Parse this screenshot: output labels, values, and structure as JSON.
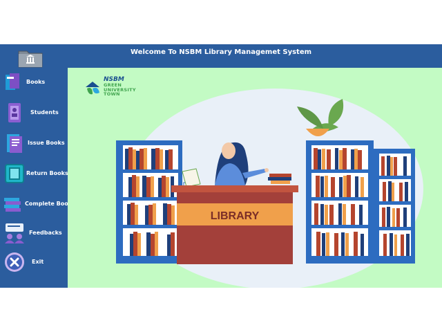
{
  "window": {
    "title": "Welcome To NSBM Library Managemet System"
  },
  "sidebar": {
    "logo_icon": "library-folder-icon",
    "items": [
      {
        "label": "Books",
        "icon": "books-icon"
      },
      {
        "label": "Students",
        "icon": "students-icon"
      },
      {
        "label": "Issue Books",
        "icon": "issue-books-icon"
      },
      {
        "label": "Return Books",
        "icon": "return-books-icon"
      },
      {
        "label": "Complete Books",
        "icon": "complete-books-icon"
      },
      {
        "label": "Feedbacks",
        "icon": "feedbacks-icon"
      },
      {
        "label": "Exit",
        "icon": "exit-icon"
      }
    ]
  },
  "brand": {
    "name": "NSBM",
    "tagline": "GREEN UNIVERSITY TOWN",
    "line1": "GREEN",
    "line2": "UNIVERSITY",
    "line3": "TOWN"
  },
  "illustration": {
    "sign": "LIBRARY"
  },
  "colors": {
    "sidebar": "#2b5d9e",
    "main_bg": "#c3fbc4",
    "desk": "#a3403a",
    "sign": "#f0a04b",
    "shelf": "#2d6cc0"
  }
}
